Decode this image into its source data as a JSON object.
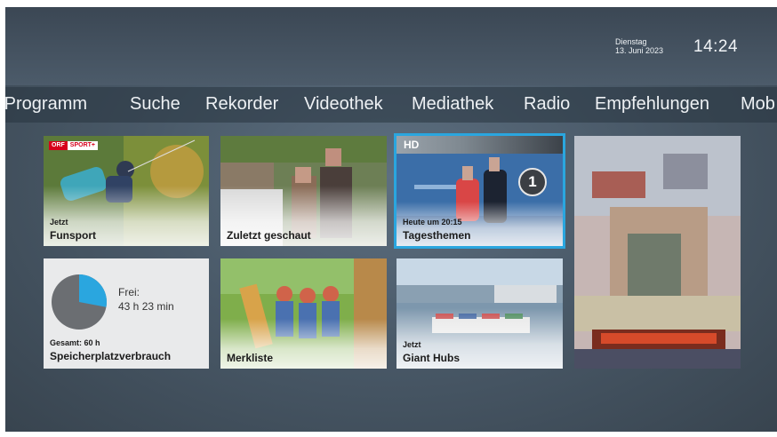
{
  "header": {
    "weekday": "Dienstag",
    "date": "13. Juni 2023",
    "time": "14:24"
  },
  "nav": {
    "items": [
      "-Programm",
      "Suche",
      "Rekorder",
      "Videothek",
      "Mediathek",
      "Radio",
      "Empfehlungen",
      "Mob"
    ]
  },
  "tiles": {
    "funsport": {
      "logo_left": "ORF",
      "logo_right": "SPORT+",
      "sub": "Jetzt",
      "title": "Funsport"
    },
    "zuletzt": {
      "title": "Zuletzt geschaut"
    },
    "tagesthemen": {
      "logo": "HD",
      "badge": "1",
      "sub": "Heute um 20:15",
      "title": "Tagesthemen"
    },
    "speicher": {
      "free_label": "Frei:",
      "free_value": "43 h 23 min",
      "total": "Gesamt: 60 h",
      "title": "Speicherplatzverbrauch",
      "free_fraction": 0.28
    },
    "merkliste": {
      "title": "Merkliste"
    },
    "gianthubs": {
      "sub": "Jetzt",
      "title": "Giant Hubs"
    }
  },
  "colors": {
    "accent": "#2aa6df",
    "pie_free": "#2aa6df",
    "pie_used": "#6b6e72"
  }
}
